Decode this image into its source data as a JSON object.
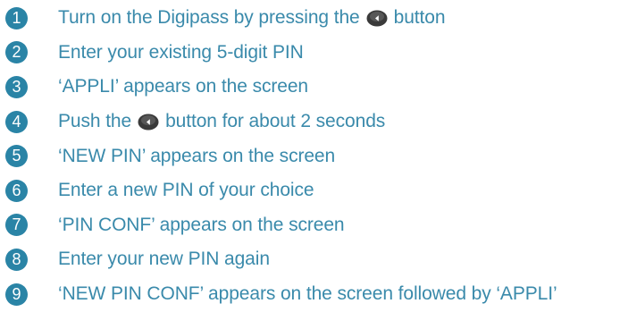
{
  "colors": {
    "accent": "#2a84a6",
    "text": "#3a8aab",
    "button_icon": "#3a3a3a"
  },
  "steps": [
    {
      "number": "1",
      "before": "Turn on the Digipass by pressing the",
      "icon": "digipass-button-icon",
      "after": "button"
    },
    {
      "number": "2",
      "before": "Enter your existing 5-digit PIN"
    },
    {
      "number": "3",
      "before": "‘APPLI’ appears on the screen"
    },
    {
      "number": "4",
      "before": "Push the",
      "icon": "digipass-button-icon",
      "after": "button for about 2 seconds"
    },
    {
      "number": "5",
      "before": "‘NEW PIN’ appears on the screen"
    },
    {
      "number": "6",
      "before": "Enter a new PIN of your choice"
    },
    {
      "number": "7",
      "before": "‘PIN CONF’ appears on the screen"
    },
    {
      "number": "8",
      "before": "Enter your new PIN again"
    },
    {
      "number": "9",
      "before": "‘NEW PIN CONF’ appears on the screen followed by ‘APPLI’"
    }
  ]
}
